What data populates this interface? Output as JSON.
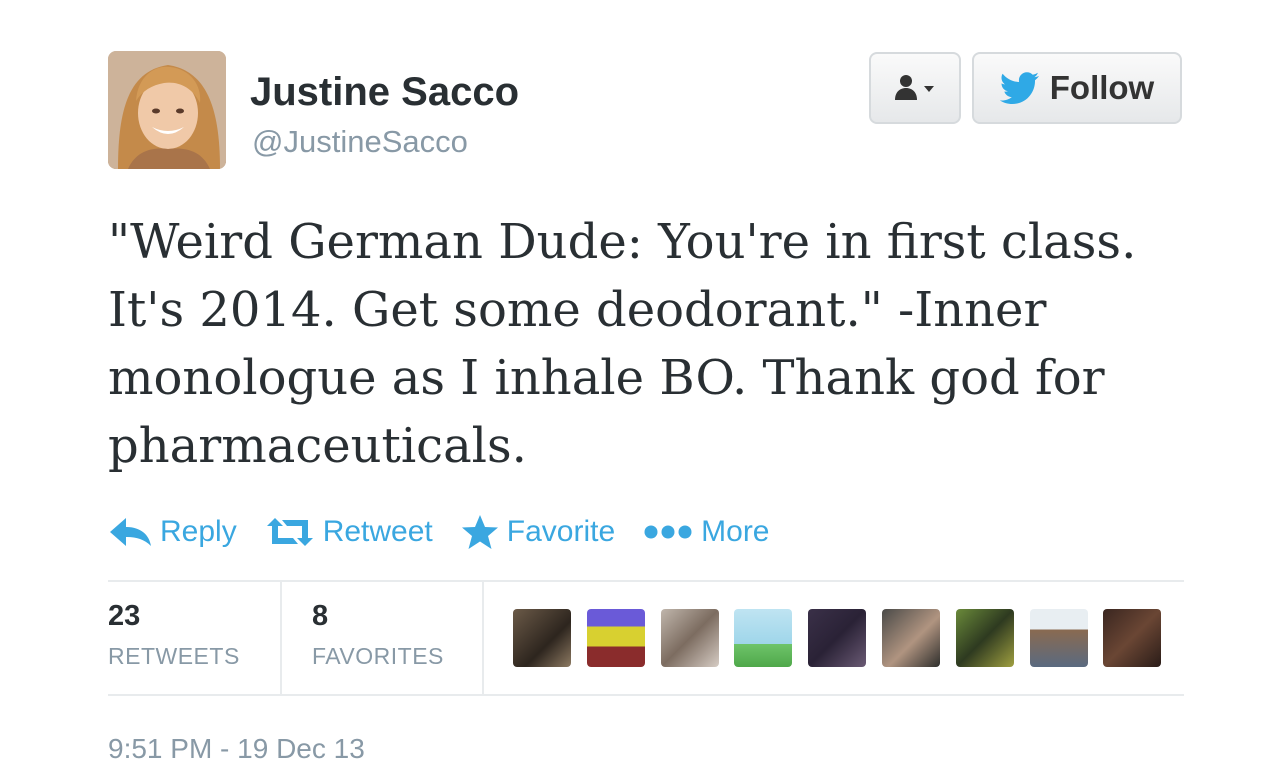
{
  "user": {
    "full_name": "Justine Sacco",
    "handle": "@JustineSacco",
    "avatar_icon": "profile-photo"
  },
  "buttons": {
    "user_menu_icon": "person-dropdown-icon",
    "follow_label": "Follow"
  },
  "tweet": {
    "text_lines": [
      "\"Weird German Dude: You're in first class.",
      "It's 2014. Get some deodorant.\" -Inner",
      "monologue as I inhale BO. Thank god for",
      "pharmaceuticals."
    ]
  },
  "actions": {
    "reply": "Reply",
    "retweet": "Retweet",
    "favorite": "Favorite",
    "more": "More"
  },
  "stats": {
    "retweets_count": "23",
    "retweets_label": "RETWEETS",
    "favorites_count": "8",
    "favorites_label": "FAVORITES"
  },
  "timestamp": "9:51 PM - 19 Dec 13",
  "colors": {
    "link_blue": "#3aa7e0",
    "muted_gray": "#8899a6",
    "text_dark": "#292f33"
  }
}
